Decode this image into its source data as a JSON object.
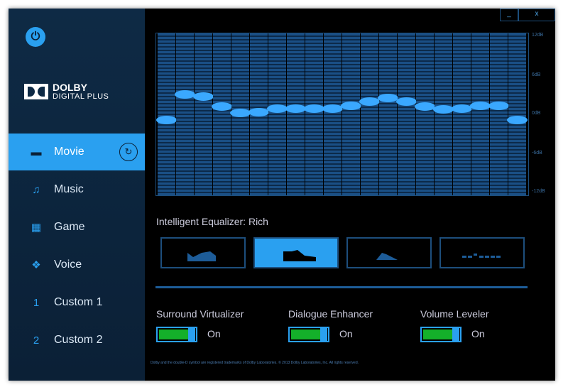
{
  "window": {
    "minimize": "_",
    "close": "x"
  },
  "brand": {
    "line1": "DOLBY",
    "line2": "DIGITAL PLUS"
  },
  "sidebar": {
    "items": [
      {
        "label": "Movie",
        "icon": "film-icon",
        "glyph": "▬",
        "selected": true
      },
      {
        "label": "Music",
        "icon": "music-note-icon",
        "glyph": "♫",
        "selected": false
      },
      {
        "label": "Game",
        "icon": "gamepad-icon",
        "glyph": "▦",
        "selected": false
      },
      {
        "label": "Voice",
        "icon": "voice-icon",
        "glyph": "❖",
        "selected": false
      },
      {
        "label": "Custom 1",
        "icon": "number-1-icon",
        "glyph": "1",
        "selected": false
      },
      {
        "label": "Custom 2",
        "icon": "number-2-icon",
        "glyph": "2",
        "selected": false
      }
    ],
    "reset_glyph": "↻"
  },
  "equalizer": {
    "y_labels": [
      "12dB",
      "6dB",
      "0dB",
      "-6dB",
      "-12dB"
    ],
    "range_db": [
      -12,
      12
    ],
    "bands_db": [
      -0.8,
      3.0,
      2.6,
      1.2,
      0.2,
      0.3,
      0.8,
      0.8,
      0.8,
      0.8,
      1.3,
      1.9,
      2.4,
      1.9,
      1.2,
      0.7,
      0.8,
      1.3,
      1.3,
      -0.8
    ]
  },
  "intelligent_eq": {
    "label": "Intelligent Equalizer: Rich",
    "selected_index": 1,
    "presets": [
      "open",
      "rich",
      "focused",
      "off"
    ]
  },
  "features": [
    {
      "label": "Surround Virtualizer",
      "state": "On"
    },
    {
      "label": "Dialogue Enhancer",
      "state": "On"
    },
    {
      "label": "Volume Leveler",
      "state": "On"
    }
  ],
  "footer": "Dolby and the double-D symbol are registered trademarks of Dolby Laboratories. © 2013 Dolby Laboratories, Inc. All rights reserved.",
  "colors": {
    "accent": "#2aa0f0",
    "sidebar": "#0e2a45",
    "toggle_on": "#14b02a"
  }
}
